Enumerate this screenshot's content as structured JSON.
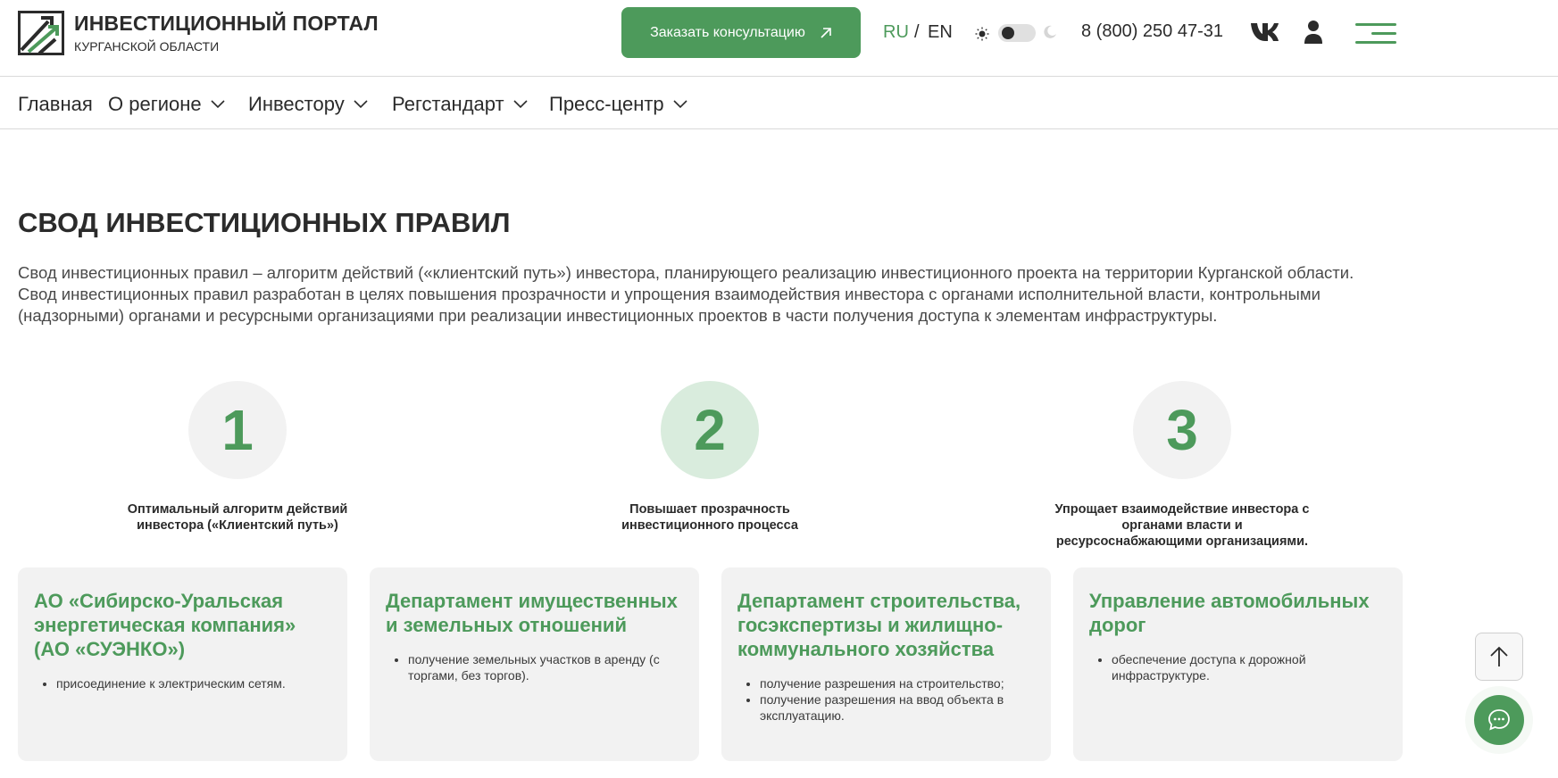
{
  "header": {
    "logo_title": "ИНВЕСТИЦИОННЫЙ ПОРТАЛ",
    "logo_subtitle": "КУРГАНСКОЙ ОБЛАСТИ",
    "consult_label": "Заказать консультацию",
    "consult_icon": "arrow-up-right-icon",
    "lang_ru": "RU",
    "lang_separator": "/",
    "lang_en": "EN",
    "theme_toggle": {
      "light_icon": "sun-icon",
      "dark_icon": "moon-icon"
    },
    "phone": "8 (800) 250 47-31",
    "social_icon": "vk-icon",
    "account_icon": "user-icon",
    "menu_icon": "burger-menu-icon"
  },
  "nav": {
    "items": [
      {
        "label": "Главная",
        "has_dropdown": false
      },
      {
        "label": "О регионе",
        "has_dropdown": true
      },
      {
        "label": "Инвестору",
        "has_dropdown": true
      },
      {
        "label": "Регстандарт",
        "has_dropdown": true
      },
      {
        "label": "Пресс-центр",
        "has_dropdown": true
      }
    ]
  },
  "main": {
    "title": "СВОД ИНВЕСТИЦИОННЫХ ПРАВИЛ",
    "intro": "Свод инвестиционных правил – алгоритм действий («клиентский путь») инвестора, планирующего реализацию инвестиционного проекта на территории Курганской области. Свод инвестиционных правил разработан в целях повышения прозрачности и упрощения взаимодействия инвестора с органами исполнительной власти, контрольными (надзорными) органами и ресурсными организациями при реализации инвестиционных проектов в части получения доступа к элементам инфраструктуры.",
    "steps": [
      {
        "number": "1",
        "caption": "Оптимальный алгоритм действий инвестора («Клиентский путь»)",
        "active": false
      },
      {
        "number": "2",
        "caption": "Повышает прозрачность инвестиционного процесса",
        "active": true
      },
      {
        "number": "3",
        "caption": "Упрощает взаимодействие инвестора с органами власти и ресурсоснабжающими организациями.",
        "active": false
      }
    ],
    "cards": [
      {
        "title": "АО «Сибирско-Уральская энергетическая компания» (АО «СУЭНКО»)",
        "items": [
          "присоединение к электрическим сетям."
        ]
      },
      {
        "title": "Департамент имущественных и земельных отношений",
        "items": [
          "получение земельных участков в аренду (с торгами, без торгов)."
        ]
      },
      {
        "title": "Департамент строительства, госэкспертизы и жилищно-коммунального хозяйства",
        "items": [
          "получение разрешения на строительство;",
          "получение разрешения на ввод объекта в эксплуатацию."
        ]
      },
      {
        "title": "Управление автомобильных дорог",
        "items": [
          "обеспечение доступа к дорожной инфраструктуре."
        ]
      }
    ]
  },
  "floating": {
    "to_top_icon": "arrow-up-icon",
    "chat_icon": "chat-icon"
  },
  "colors": {
    "accent": "#4d9a5b",
    "step_circle": "#f2f2f2",
    "step_circle_active": "#d9ecdd",
    "card_bg": "#f2f2f2",
    "text": "#2b2b2b"
  }
}
